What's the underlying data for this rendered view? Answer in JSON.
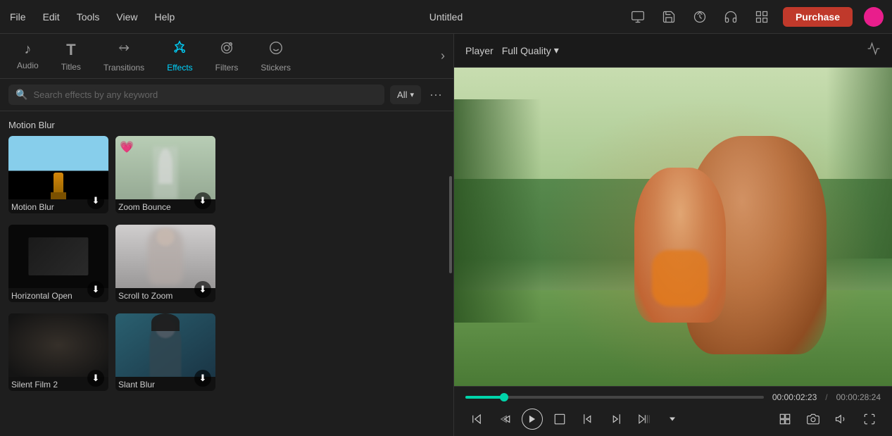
{
  "app": {
    "title": "Untitled",
    "purchase_label": "Purchase"
  },
  "menu": {
    "items": [
      "File",
      "Edit",
      "Tools",
      "View",
      "Help"
    ]
  },
  "tabs": [
    {
      "id": "audio",
      "label": "Audio",
      "icon": "♪",
      "active": false
    },
    {
      "id": "titles",
      "label": "Titles",
      "icon": "T",
      "active": false
    },
    {
      "id": "transitions",
      "label": "Transitions",
      "icon": "↔",
      "active": false
    },
    {
      "id": "effects",
      "label": "Effects",
      "icon": "✦",
      "active": true
    },
    {
      "id": "filters",
      "label": "Filters",
      "icon": "❋",
      "active": false
    },
    {
      "id": "stickers",
      "label": "Stickers",
      "icon": "◈",
      "active": false
    }
  ],
  "search": {
    "placeholder": "Search effects by any keyword",
    "filter_label": "All"
  },
  "sections": [
    {
      "id": "motion-blur-section",
      "title": "Motion Blur",
      "effects": [
        {
          "id": "motion-blur",
          "label": "Motion Blur",
          "has_download": true,
          "has_favorite": false
        },
        {
          "id": "zoom-bounce",
          "label": "Zoom Bounce",
          "has_download": true,
          "has_favorite": true
        }
      ]
    },
    {
      "id": "horizontal-section",
      "title": "",
      "effects": [
        {
          "id": "horizontal-open",
          "label": "Horizontal Open",
          "has_download": true,
          "has_favorite": false
        },
        {
          "id": "scroll-to-zoom",
          "label": "Scroll to Zoom",
          "has_download": true,
          "has_favorite": false
        }
      ]
    },
    {
      "id": "silent-section",
      "title": "",
      "effects": [
        {
          "id": "silent-film-2",
          "label": "Silent Film 2",
          "has_download": true,
          "has_favorite": false
        },
        {
          "id": "slant-blur",
          "label": "Slant Blur",
          "has_download": true,
          "has_favorite": false
        }
      ]
    }
  ],
  "player": {
    "label": "Player",
    "quality_label": "Full Quality",
    "time_current": "00:00:02:23",
    "time_separator": "/",
    "time_total": "00:00:28:24"
  },
  "controls": {
    "skip_back": "⏮",
    "step_back": "◁",
    "play": "▶",
    "stop": "□",
    "mark_in": "{",
    "mark_out": "}",
    "ripple": "⊳|",
    "layout": "⊡",
    "snapshot": "⊙",
    "volume": "♪",
    "fullscreen": "⛶"
  }
}
